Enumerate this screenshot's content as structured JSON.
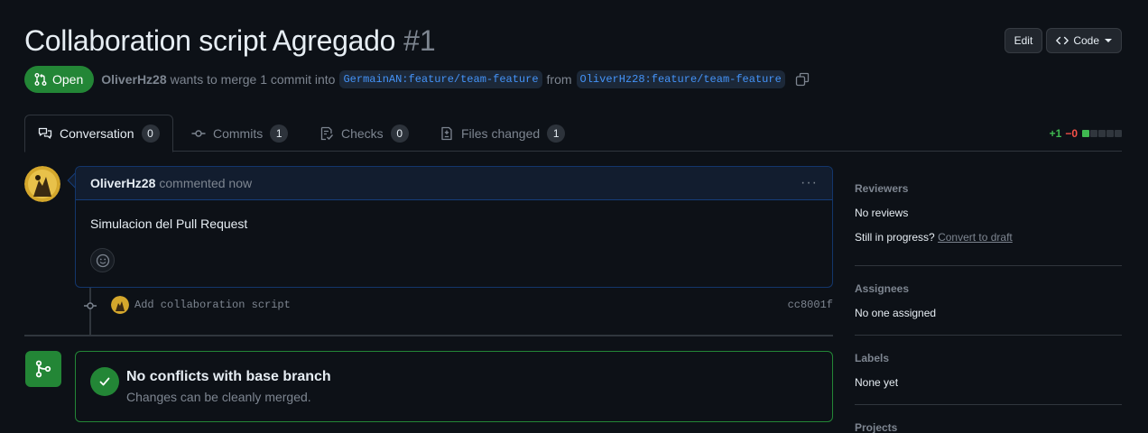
{
  "header": {
    "title": "Collaboration script Agregado",
    "number": "#1",
    "edit_label": "Edit",
    "code_label": "Code"
  },
  "meta": {
    "state": "Open",
    "author": "OliverHz28",
    "action_text": "wants to merge 1 commit into",
    "base_branch": "GermainAN:feature/team-feature",
    "from_text": "from",
    "head_branch": "OliverHz28:feature/team-feature"
  },
  "tabs": [
    {
      "label": "Conversation",
      "count": "0",
      "icon": "comment-discussion-icon"
    },
    {
      "label": "Commits",
      "count": "1",
      "icon": "git-commit-icon"
    },
    {
      "label": "Checks",
      "count": "0",
      "icon": "checklist-icon"
    },
    {
      "label": "Files changed",
      "count": "1",
      "icon": "file-diff-icon"
    }
  ],
  "diffstat": {
    "additions": "+1",
    "deletions": "−0",
    "colors": [
      "#3fb950",
      "#30363d",
      "#30363d",
      "#30363d",
      "#30363d"
    ]
  },
  "comment": {
    "author": "OliverHz28",
    "time": "commented now",
    "body": "Simulacion del Pull Request"
  },
  "commit": {
    "message": "Add collaboration script",
    "sha": "cc8001f"
  },
  "merge_status": {
    "title": "No conflicts with base branch",
    "subtitle": "Changes can be cleanly merged."
  },
  "sidebar": {
    "reviewers": {
      "title": "Reviewers",
      "value": "No reviews",
      "progress_text": "Still in progress?",
      "progress_link": "Convert to draft"
    },
    "assignees": {
      "title": "Assignees",
      "value": "No one assigned"
    },
    "labels": {
      "title": "Labels",
      "value": "None yet"
    },
    "projects": {
      "title": "Projects"
    }
  },
  "colors": {
    "accent_green": "#238636",
    "link_blue": "#4493f8",
    "bg": "#0d1117"
  }
}
